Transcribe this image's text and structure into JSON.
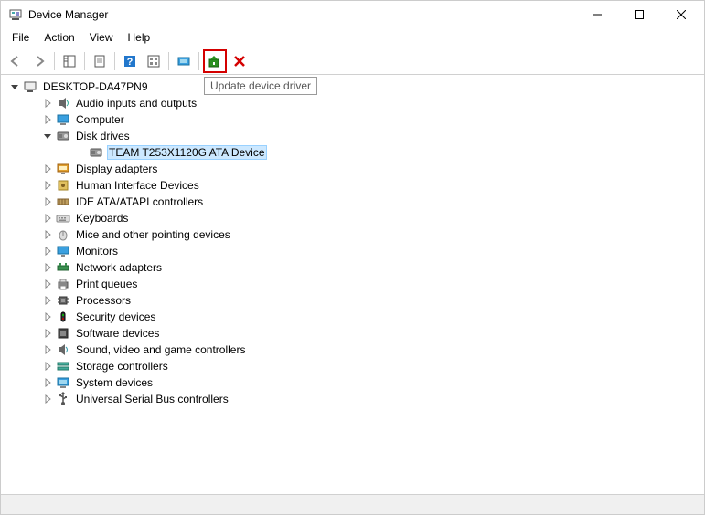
{
  "window": {
    "title": "Device Manager"
  },
  "menubar": {
    "items": [
      "File",
      "Action",
      "View",
      "Help"
    ]
  },
  "toolbar": {
    "back": "back",
    "forward": "forward",
    "show_hide_tree": "show-hide-console-tree",
    "properties": "properties",
    "help": "help",
    "action_show": "show-hidden",
    "scan": "scan-hardware",
    "update_driver": "update-driver",
    "uninstall": "uninstall-device"
  },
  "tooltip": "Update device driver",
  "tree": {
    "root": {
      "label": "DESKTOP-DA47PN9",
      "expanded": true,
      "icon": "computer-root"
    },
    "categories": [
      {
        "label": "Audio inputs and outputs",
        "expanded": false,
        "icon": "audio"
      },
      {
        "label": "Computer",
        "expanded": false,
        "icon": "computer"
      },
      {
        "label": "Disk drives",
        "expanded": true,
        "icon": "disk",
        "children": [
          {
            "label": "TEAM T253X1120G ATA Device",
            "icon": "disk",
            "selected": true
          }
        ]
      },
      {
        "label": "Display adapters",
        "expanded": false,
        "icon": "display"
      },
      {
        "label": "Human Interface Devices",
        "expanded": false,
        "icon": "hid"
      },
      {
        "label": "IDE ATA/ATAPI controllers",
        "expanded": false,
        "icon": "ide"
      },
      {
        "label": "Keyboards",
        "expanded": false,
        "icon": "keyboard"
      },
      {
        "label": "Mice and other pointing devices",
        "expanded": false,
        "icon": "mouse"
      },
      {
        "label": "Monitors",
        "expanded": false,
        "icon": "monitor"
      },
      {
        "label": "Network adapters",
        "expanded": false,
        "icon": "network"
      },
      {
        "label": "Print queues",
        "expanded": false,
        "icon": "printer"
      },
      {
        "label": "Processors",
        "expanded": false,
        "icon": "cpu"
      },
      {
        "label": "Security devices",
        "expanded": false,
        "icon": "security"
      },
      {
        "label": "Software devices",
        "expanded": false,
        "icon": "software"
      },
      {
        "label": "Sound, video and game controllers",
        "expanded": false,
        "icon": "sound"
      },
      {
        "label": "Storage controllers",
        "expanded": false,
        "icon": "storage"
      },
      {
        "label": "System devices",
        "expanded": false,
        "icon": "system"
      },
      {
        "label": "Universal Serial Bus controllers",
        "expanded": false,
        "icon": "usb"
      }
    ]
  }
}
